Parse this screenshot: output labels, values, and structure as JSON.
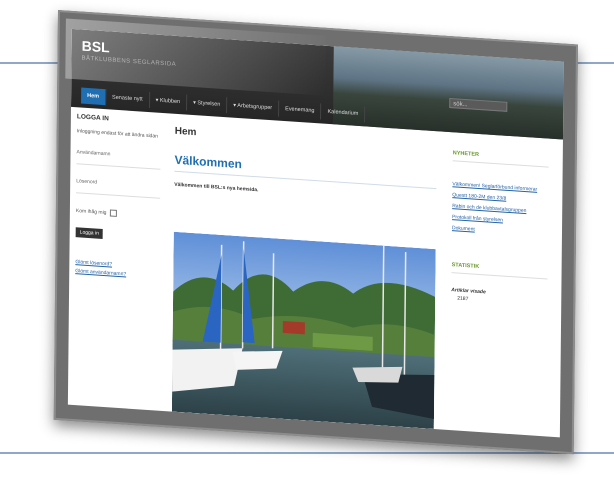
{
  "site": {
    "title": "BSL",
    "subtitle": "BÅTKLUBBENS SEGLARSIDA"
  },
  "search": {
    "placeholder": "sök..."
  },
  "nav": [
    {
      "label": "Hem",
      "active": true
    },
    {
      "label": "Senaste nytt"
    },
    {
      "label": "▾ Klubben"
    },
    {
      "label": "▾ Styrelsen"
    },
    {
      "label": "▾ Arbetsgrupper"
    },
    {
      "label": "Evenemang"
    },
    {
      "label": "Kalendarium"
    }
  ],
  "login": {
    "title": "LOGGA IN",
    "info": "Inloggning endast för att ändra sidan",
    "username_label": "Användarnamn",
    "password_label": "Lösenord",
    "remember_label": "Kom ihåg mig",
    "button_label": "Logga in",
    "forgot_password": "Glömt lösenord?",
    "forgot_username": "Glömt användarnamn?"
  },
  "main": {
    "page_title": "Hem",
    "welcome_heading": "Välkommen",
    "intro_text": "Välkommen till BSL:s nya hemsida."
  },
  "sidebar": {
    "news_heading": "NYHETER",
    "news_items": [
      "Välkommen! Seglarförbund informerar",
      "Questt 180-2M den 23/8",
      "Rabin och de klubbavtalsgruppen",
      "Protokoll från styrelsen",
      "Dokument"
    ],
    "stats_heading": "STATISTIK",
    "stats_label": "Artiklar visade",
    "stats_value": "2187"
  },
  "colors": {
    "accent": "#1f6fb2",
    "sidebar_heading": "#6a9a2a",
    "header": "#2b2b2b",
    "frame": "#6f6f6f"
  }
}
